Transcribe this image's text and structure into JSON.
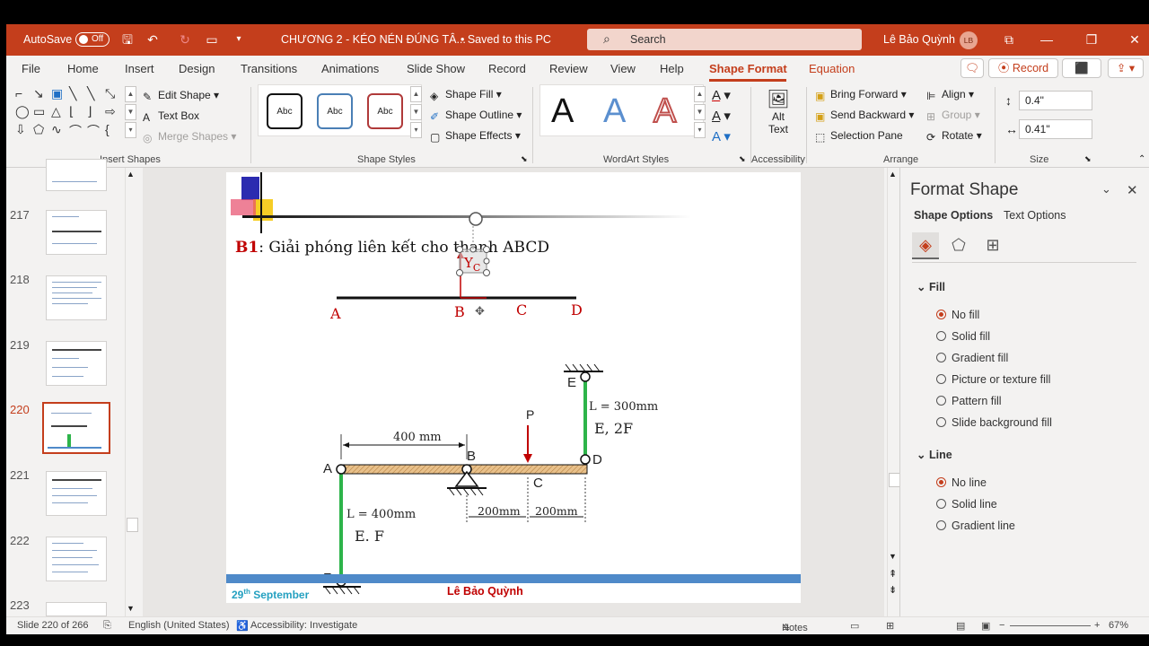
{
  "titlebar": {
    "autosave_label": "AutoSave",
    "autosave_state": "Off",
    "doc_title": "CHƯƠNG 2 - KÉO NÉN ĐÚNG TÂ...",
    "save_status": "• Saved to this PC",
    "search_placeholder": "Search",
    "user_name": "Lê Bảo Quỳnh",
    "user_initials": "LB",
    "accent": "#c43e1c"
  },
  "menu": {
    "tabs": [
      "File",
      "Home",
      "Insert",
      "Design",
      "Transitions",
      "Animations",
      "Slide Show",
      "Record",
      "Review",
      "View",
      "Help",
      "Shape Format",
      "Equation"
    ],
    "active_tab": "Shape Format",
    "record_button": "Record"
  },
  "ribbon": {
    "insert_shapes": {
      "label": "Insert Shapes",
      "edit_shape": "Edit Shape",
      "text_box": "Text Box",
      "merge_shapes": "Merge Shapes"
    },
    "shape_styles": {
      "label": "Shape Styles",
      "presets": [
        "Abc",
        "Abc",
        "Abc"
      ],
      "shape_fill": "Shape Fill",
      "shape_outline": "Shape Outline",
      "shape_effects": "Shape Effects"
    },
    "wordart": {
      "label": "WordArt Styles",
      "letters": [
        "A",
        "A",
        "A"
      ]
    },
    "accessibility": {
      "label": "Accessibility",
      "alt_text_line1": "Alt",
      "alt_text_line2": "Text"
    },
    "arrange": {
      "label": "Arrange",
      "bring_forward": "Bring Forward",
      "send_backward": "Send Backward",
      "selection_pane": "Selection Pane",
      "align": "Align",
      "group": "Group",
      "rotate": "Rotate"
    },
    "size": {
      "label": "Size",
      "height": "0.4\"",
      "width": "0.41\""
    }
  },
  "thumbnails": {
    "numbers": [
      "217",
      "218",
      "219",
      "220",
      "221",
      "222",
      "223"
    ],
    "active": "220"
  },
  "slide": {
    "title_bold": "B1",
    "title_rest": ": Giải phóng liên kết cho thanh ABCD",
    "footer_date": "29",
    "footer_date_sup": "th",
    "footer_date_rest": " September",
    "footer_author": "Lê Bảo Quỳnh",
    "top_beam": {
      "labels": [
        "A",
        "B",
        "C",
        "D"
      ],
      "reaction": "Y",
      "reaction_sub": "C"
    },
    "structure": {
      "dim_ab": "400 mm",
      "dim_bc": "200mm",
      "dim_cd": "200mm",
      "load": "P",
      "points": [
        "A",
        "B",
        "C",
        "D",
        "E",
        "F"
      ],
      "rod_ed_length": "L = 300mm",
      "rod_ed_props": "E, 2F",
      "rod_af_length": "L = 400mm",
      "rod_af_props": "E. F"
    }
  },
  "format_pane": {
    "title": "Format Shape",
    "tabs": [
      "Shape Options",
      "Text Options"
    ],
    "fill_header": "Fill",
    "fill_options": [
      "No fill",
      "Solid fill",
      "Gradient fill",
      "Picture or texture fill",
      "Pattern fill",
      "Slide background fill"
    ],
    "fill_selected": "No fill",
    "line_header": "Line",
    "line_options": [
      "No line",
      "Solid line",
      "Gradient line"
    ],
    "line_selected": "No line"
  },
  "statusbar": {
    "slide_info": "Slide 220 of 266",
    "language": "English (United States)",
    "accessibility": "Accessibility: Investigate",
    "notes": "Notes",
    "zoom": "67%"
  }
}
